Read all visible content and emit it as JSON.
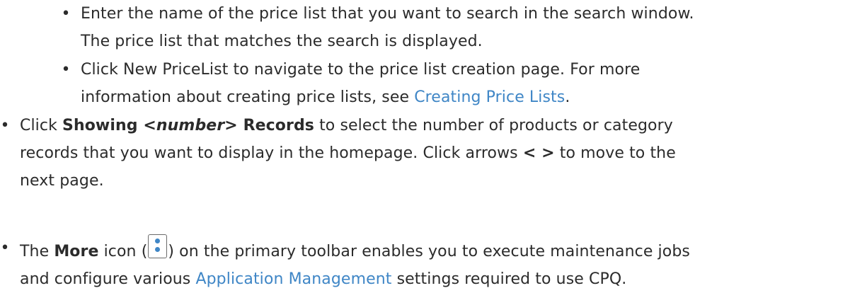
{
  "bullets": {
    "sub1": {
      "symbol": "•",
      "line1": "Enter the name of the price list that you want to search in the search window.",
      "line2": "The price list that matches the search is displayed."
    },
    "sub2": {
      "symbol": "•",
      "line1": "Click New PriceList to navigate to the price list creation page. For more",
      "line2_prefix": "information about creating price lists, see ",
      "link": "Creating Price Lists",
      "line2_suffix": "."
    },
    "main1": {
      "symbol": "•",
      "click": "Click ",
      "showing": "Showing ",
      "number": "<number>",
      "records": " Records",
      "line1_rest": " to select the number of products or category",
      "line2_prefix": "records that you want to display in the homepage. Click arrows ",
      "arrows": "< >",
      "line2_suffix": " to move to the",
      "line3": "next page."
    },
    "main2": {
      "symbol": "•",
      "the": "The ",
      "more": "More",
      "icon_prefix": " icon (",
      "icon_name": "vertical-ellipsis-icon",
      "icon_suffix": ") on the primary toolbar enables you to execute maintenance jobs",
      "line2_prefix": "and configure various ",
      "link": "Application Management",
      "line2_suffix": " settings required to use CPQ."
    }
  },
  "colors": {
    "text": "#2b2b2b",
    "link": "#3f86c6",
    "icon_border": "#6b6b6b",
    "icon_dots": "#3f86c6"
  }
}
